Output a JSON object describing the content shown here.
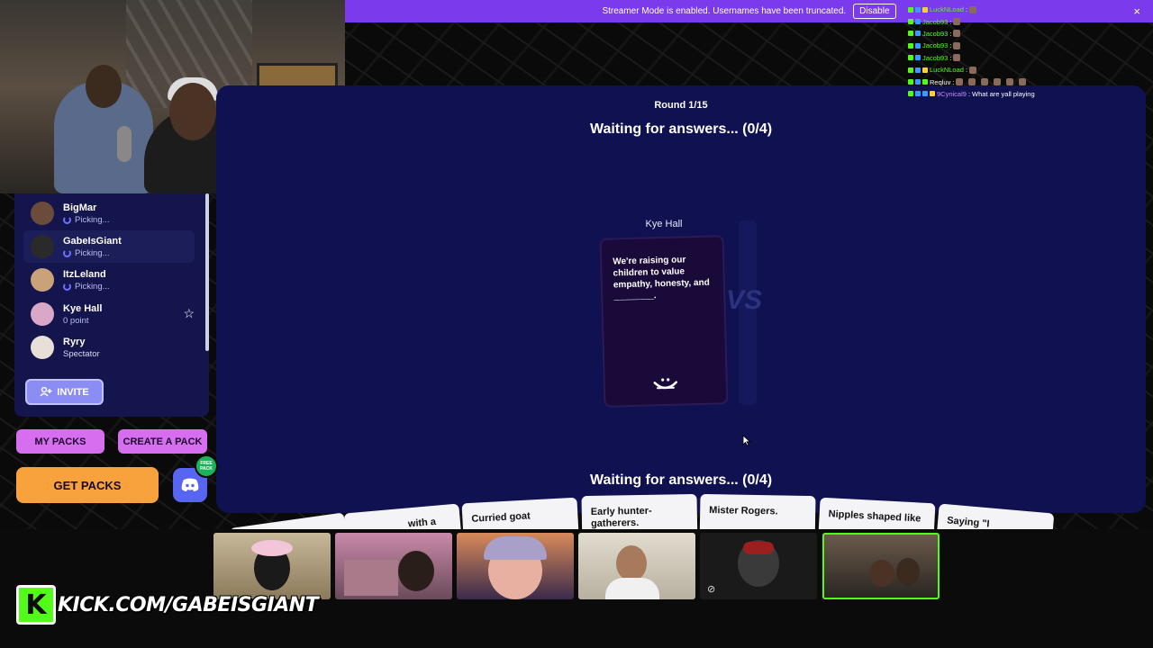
{
  "banner": {
    "text": "Streamer Mode is enabled. Usernames have been truncated.",
    "disable_label": "Disable",
    "close": "×"
  },
  "game": {
    "round": "Round 1/15",
    "waiting_top": "Waiting for answers... (0/4)",
    "waiting_bottom": "Waiting for answers... (0/4)",
    "card_owner": "Kye Hall",
    "prompt": "We're raising our children to value empathy, honesty, and ________."
  },
  "players": [
    {
      "name": "BigMar",
      "status": "Picking...",
      "avatar_color": "#6b4b3a",
      "spinner": true
    },
    {
      "name": "GabeIsGiant",
      "status": "Picking...",
      "avatar_color": "#2a2a2a",
      "spinner": true,
      "active": true
    },
    {
      "name": "ItzLeland",
      "status": "Picking...",
      "avatar_color": "#c9a27a",
      "spinner": true
    },
    {
      "name": "Kye Hall",
      "status": "0 point",
      "avatar_color": "#d9a7c8",
      "spinner": false,
      "star": true
    },
    {
      "name": "Ryry",
      "status": "Spectator",
      "avatar_color": "#e8e0d8",
      "spinner": false
    }
  ],
  "buttons": {
    "invite": "INVITE",
    "my_packs": "MY PACKS",
    "create_pack": "CREATE A PACK",
    "get_packs": "GET PACKS",
    "free_badge": "FREE PACK"
  },
  "chat": [
    {
      "user": "LuckNLoad",
      "msg": "",
      "color": "#53fc18"
    },
    {
      "user": "Jacob93",
      "msg": "",
      "color": "#53fc18"
    },
    {
      "user": "Jacob93",
      "msg": "",
      "color": "#53fc18"
    },
    {
      "user": "Jacob93",
      "msg": "",
      "color": "#53fc18"
    },
    {
      "user": "Jacob93",
      "msg": "",
      "color": "#53fc18"
    },
    {
      "user": "LuckNLoad",
      "msg": "",
      "color": "#53fc18"
    },
    {
      "user": "Reqluv",
      "msg": "",
      "color": "#ffffff"
    },
    {
      "user": "9Cynical9",
      "msg": "What are yall playing",
      "color": "#c98bff"
    }
  ],
  "answer_cards": [
    "with a",
    "Curried goat",
    "Early hunter-gatherers.",
    "Mister Rogers.",
    "Nipples shaped like",
    "Saying \"I"
  ],
  "kick": {
    "k": "K",
    "url": "KICK.COM/GABEISGIANT"
  },
  "colors": {
    "panel": "#0f1150",
    "sidebar": "#14154c",
    "banner": "#7c3aed",
    "kick_green": "#53fc18",
    "pink_btn": "#d76ef0",
    "orange_btn": "#f7a23c",
    "discord": "#5865f2"
  }
}
